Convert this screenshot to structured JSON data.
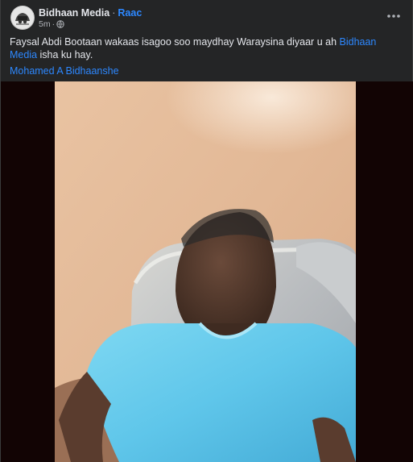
{
  "post": {
    "author": "Bidhaan Media",
    "separator": "·",
    "follow_label": "Raac",
    "timestamp": "5m",
    "meta_separator": "·",
    "privacy_icon": "globe-icon",
    "more_icon": "more-horizontal-icon",
    "caption_text": "Faysal Abdi Bootaan wakaas isagoo soo maydhay Waraysina diyaar u ah ",
    "caption_link": "Bidhaan Media",
    "caption_suffix": " isha ku hay.",
    "credit": "Mohamed A Bidhaanshe",
    "photo_icon": "photo-man-blue-shirt"
  },
  "colors": {
    "background": "#242526",
    "text_primary": "#e4e6eb",
    "text_secondary": "#b0b3b8",
    "link": "#2d88ff",
    "media_bg": "#120404"
  }
}
